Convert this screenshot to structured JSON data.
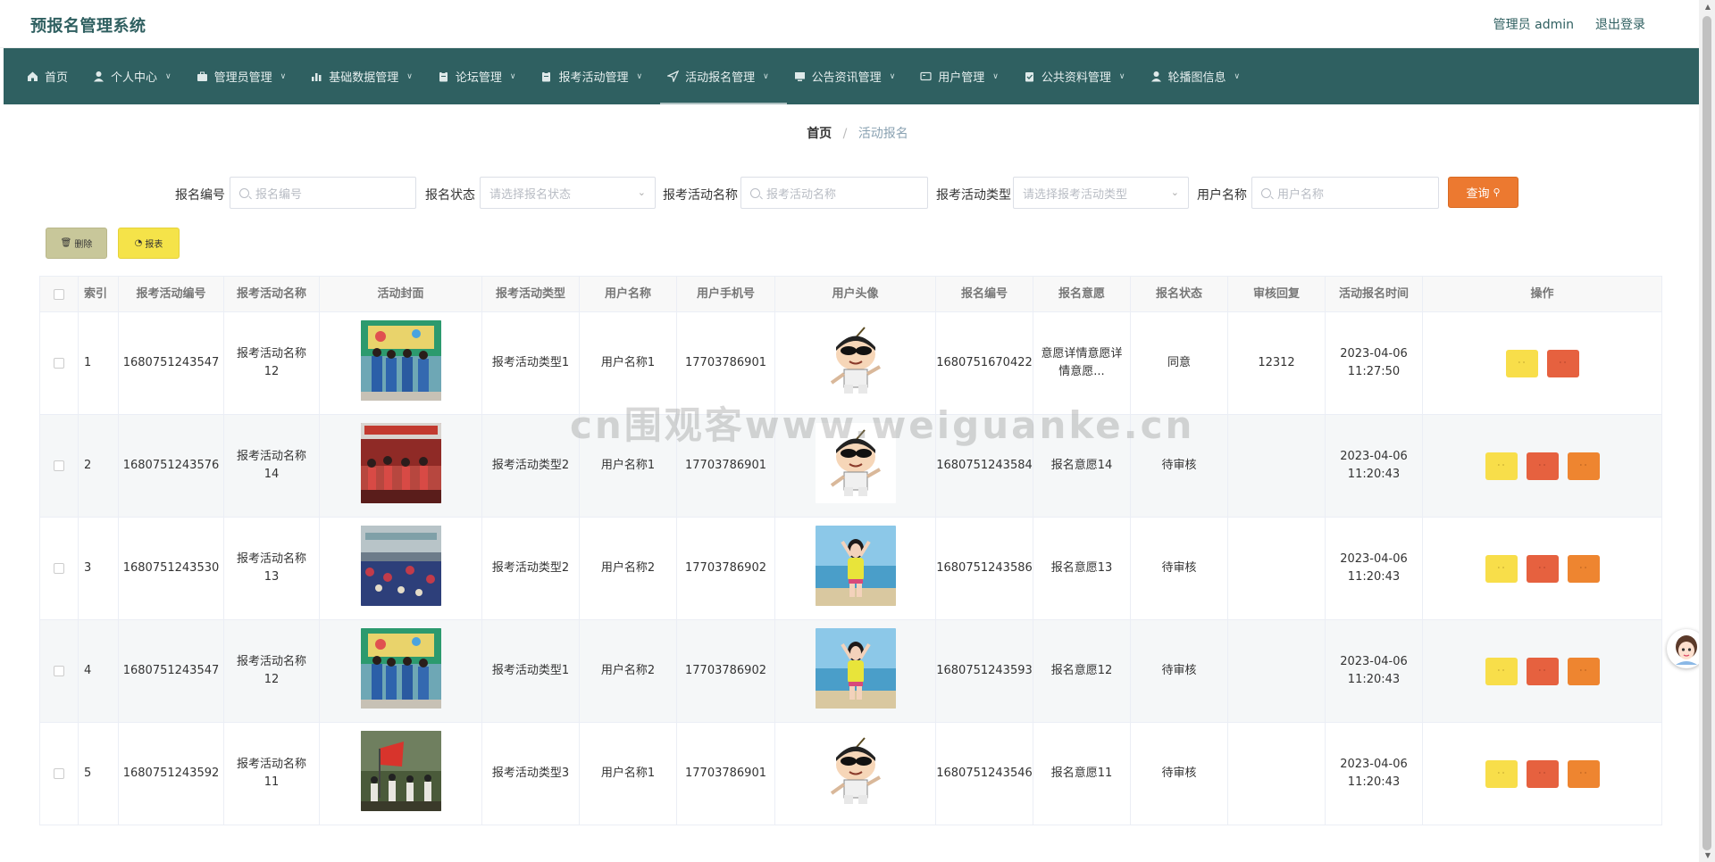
{
  "header": {
    "app_title": "预报名管理系统",
    "admin_label": "管理员 admin",
    "logout_label": "退出登录"
  },
  "nav": {
    "items": [
      {
        "label": "首页",
        "icon": "home-icon",
        "has_dropdown": false
      },
      {
        "label": "个人中心",
        "icon": "user-icon",
        "has_dropdown": true
      },
      {
        "label": "管理员管理",
        "icon": "briefcase-icon",
        "has_dropdown": true
      },
      {
        "label": "基础数据管理",
        "icon": "bar-chart-icon",
        "has_dropdown": true
      },
      {
        "label": "论坛管理",
        "icon": "clipboard-icon",
        "has_dropdown": true
      },
      {
        "label": "报考活动管理",
        "icon": "clipboard-icon",
        "has_dropdown": true
      },
      {
        "label": "活动报名管理",
        "icon": "send-icon",
        "has_dropdown": true,
        "active": true
      },
      {
        "label": "公告资讯管理",
        "icon": "monitor-icon",
        "has_dropdown": true
      },
      {
        "label": "用户管理",
        "icon": "card-icon",
        "has_dropdown": true
      },
      {
        "label": "公共资料管理",
        "icon": "check-clipboard-icon",
        "has_dropdown": true
      },
      {
        "label": "轮播图信息",
        "icon": "user-icon",
        "has_dropdown": true
      }
    ]
  },
  "breadcrumb": {
    "home": "首页",
    "separator": "/",
    "current": "活动报名"
  },
  "search": {
    "fields": [
      {
        "label": "报名编号",
        "placeholder": "报名编号",
        "type": "input"
      },
      {
        "label": "报名状态",
        "placeholder": "请选择报名状态",
        "type": "select"
      },
      {
        "label": "报考活动名称",
        "placeholder": "报考活动名称",
        "type": "input"
      },
      {
        "label": "报考活动类型",
        "placeholder": "请选择报考活动类型",
        "type": "select"
      },
      {
        "label": "用户名称",
        "placeholder": "用户名称",
        "type": "input"
      }
    ],
    "query_label": "查询"
  },
  "actions": {
    "delete_label": "删除",
    "report_label": "报表"
  },
  "table": {
    "columns": [
      "索引",
      "报考活动编号",
      "报考活动名称",
      "活动封面",
      "报考活动类型",
      "用户名称",
      "用户手机号",
      "用户头像",
      "报名编号",
      "报名意愿",
      "报名状态",
      "审核回复",
      "活动报名时间",
      "操作"
    ],
    "rows": [
      {
        "index": "1",
        "activity_no": "1680751243547",
        "activity_name": "报考活动名称12",
        "cover": "classroom-students",
        "activity_type": "报考活动类型1",
        "user_name": "用户名称1",
        "phone": "17703786901",
        "avatar": "cartoon-boy",
        "signup_no": "1680751670422",
        "wish": "意愿详情意愿详情意愿...",
        "status": "同意",
        "reply": "12312",
        "time": "2023-04-06 11:27:50",
        "ops": [
          "y",
          "r"
        ]
      },
      {
        "index": "2",
        "activity_no": "1680751243576",
        "activity_name": "报考活动名称14",
        "cover": "dance-hall",
        "activity_type": "报考活动类型2",
        "user_name": "用户名称1",
        "phone": "17703786901",
        "avatar": "cartoon-boy",
        "signup_no": "1680751243584",
        "wish": "报名意愿14",
        "status": "待审核",
        "reply": "",
        "time": "2023-04-06 11:20:43",
        "ops": [
          "y",
          "r",
          "o"
        ]
      },
      {
        "index": "3",
        "activity_no": "1680751243530",
        "activity_name": "报考活动名称13",
        "cover": "gym-crowd",
        "activity_type": "报考活动类型2",
        "user_name": "用户名称2",
        "phone": "17703786902",
        "avatar": "girl-beach",
        "signup_no": "1680751243586",
        "wish": "报名意愿13",
        "status": "待审核",
        "reply": "",
        "time": "2023-04-06 11:20:43",
        "ops": [
          "y",
          "r",
          "o"
        ]
      },
      {
        "index": "4",
        "activity_no": "1680751243547",
        "activity_name": "报考活动名称12",
        "cover": "classroom-students",
        "activity_type": "报考活动类型1",
        "user_name": "用户名称2",
        "phone": "17703786902",
        "avatar": "girl-beach",
        "signup_no": "1680751243593",
        "wish": "报名意愿12",
        "status": "待审核",
        "reply": "",
        "time": "2023-04-06 11:20:43",
        "ops": [
          "y",
          "r",
          "o"
        ]
      },
      {
        "index": "5",
        "activity_no": "1680751243592",
        "activity_name": "报考活动名称11",
        "cover": "outdoor-flag",
        "activity_type": "报考活动类型3",
        "user_name": "用户名称1",
        "phone": "17703786901",
        "avatar": "cartoon-boy",
        "signup_no": "1680751243546",
        "wish": "报名意愿11",
        "status": "待审核",
        "reply": "",
        "time": "2023-04-06 11:20:43",
        "ops": [
          "y",
          "r",
          "o"
        ]
      }
    ]
  },
  "watermark": "cn围观客www.weiguanke.cn",
  "colors": {
    "nav_bg": "#2f6061",
    "title": "#2f5f60",
    "query": "#ec7930",
    "delete": "#c8c79a",
    "report": "#f5e349",
    "op_yellow": "#f8de4a",
    "op_red": "#e6613f",
    "op_orange": "#ee8530"
  }
}
